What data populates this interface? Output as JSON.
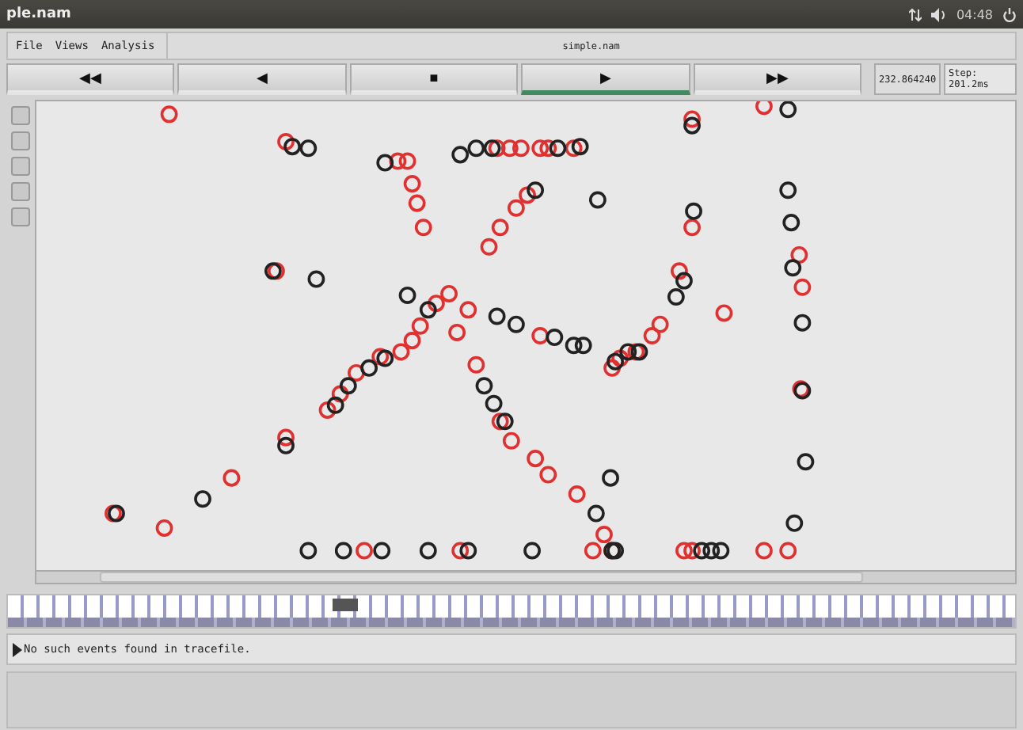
{
  "topbar": {
    "title": "ple.nam",
    "clock": "04:48"
  },
  "menu": {
    "items": [
      "File",
      "Views",
      "Analysis"
    ],
    "file_label": "simple.nam"
  },
  "transport": [
    {
      "label": "◀◀",
      "selected": false
    },
    {
      "label": "◀",
      "selected": false
    },
    {
      "label": "■",
      "selected": false
    },
    {
      "label": "▶",
      "selected": true
    },
    {
      "label": "▶▶",
      "selected": false
    }
  ],
  "time_reading": "232.864240",
  "step": "Step: 201.2ms",
  "status": "No such events found in tracefile."
}
